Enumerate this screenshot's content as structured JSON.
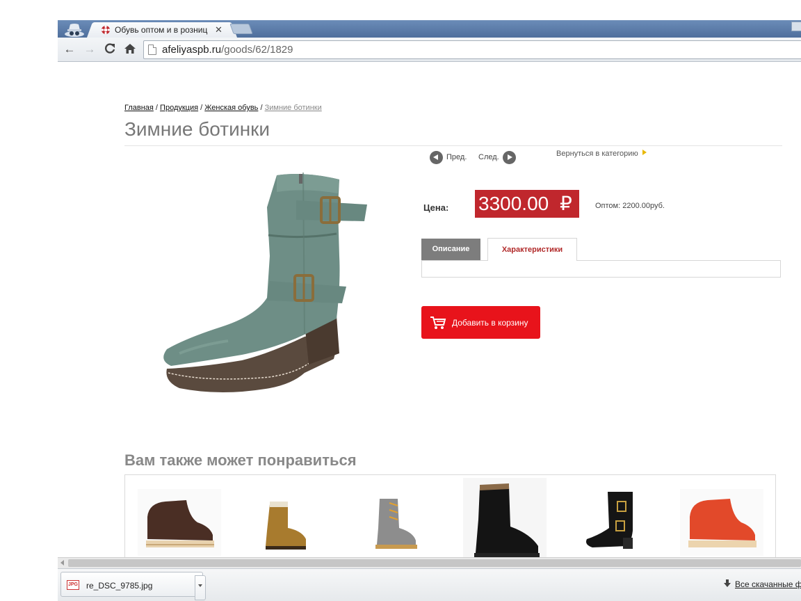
{
  "browser": {
    "tab_title": "Обувь оптом и в розниц",
    "tab_close": "✕",
    "url_host": "afeliyaspb.ru",
    "url_path": "/goods/62/1829",
    "nav": {
      "back": "←",
      "forward": "→",
      "reload": "C",
      "home": "⌂"
    }
  },
  "breadcrumb": {
    "items": [
      "Главная",
      "Продукция",
      "Женская обувь"
    ],
    "separator": " / ",
    "current": "Зимние ботинки"
  },
  "product": {
    "title": "Зимние ботинки",
    "prev_label": "Пред.",
    "next_label": "След.",
    "back_to_category": "Вернуться в категорию",
    "price_label": "Цена:",
    "price_value": "3300.00",
    "currency_symbol": "₽",
    "wholesale_price": "Оптом: 2200.00руб.",
    "tabs": [
      {
        "label": "Описание",
        "active": false
      },
      {
        "label": "Характеристики",
        "active": true
      }
    ],
    "add_to_cart_label": "Добавить в корзину"
  },
  "related": {
    "heading": "Вам также может понравиться",
    "items": [
      {
        "icon": "brown-chukka-boot-image"
      },
      {
        "icon": "tan-fur-boot-image"
      },
      {
        "icon": "grey-lace-boot-image"
      },
      {
        "icon": "black-lace-high-boot-image"
      },
      {
        "icon": "black-buckle-boot-image"
      },
      {
        "icon": "orange-chukka-boot-image"
      }
    ]
  },
  "downloads": {
    "file_name": "re_DSC_9785.jpg",
    "file_type": "JPG",
    "all_downloads_label": "Все скачанные ф"
  },
  "colors": {
    "price_bg": "#c0272d",
    "cart_button_bg": "#e8131b",
    "active_tab_text": "#b12a2a",
    "inactive_tab_bg": "#7d7d7d",
    "category_arrow": "#e8b800",
    "tabstrip": "#5a7ba7"
  }
}
